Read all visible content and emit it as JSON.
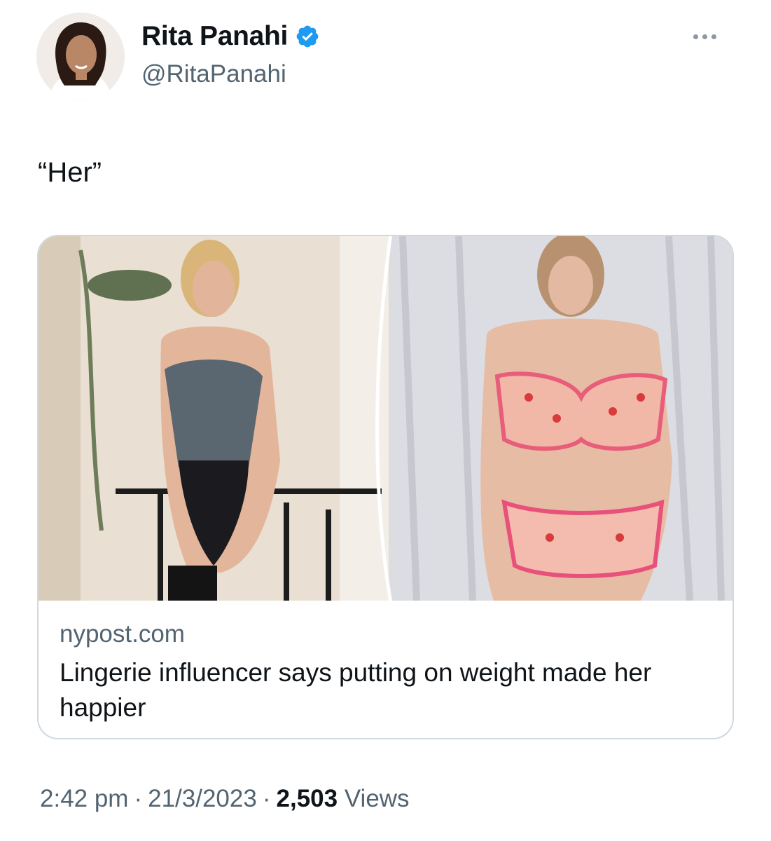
{
  "author": {
    "display_name": "Rita Panahi",
    "handle": "@RitaPanahi",
    "verified": true,
    "verified_color": "#1d9bf0"
  },
  "tweet": {
    "text": "“Her”"
  },
  "card": {
    "domain": "nypost.com",
    "title": "Lingerie influencer says putting on weight made her happier"
  },
  "meta": {
    "time": "2:42 pm",
    "date": "21/3/2023",
    "separator": "·",
    "views_count": "2,503",
    "views_label": "Views"
  },
  "icons": {
    "verified": "verified-badge-icon",
    "more": "more-options-icon"
  }
}
